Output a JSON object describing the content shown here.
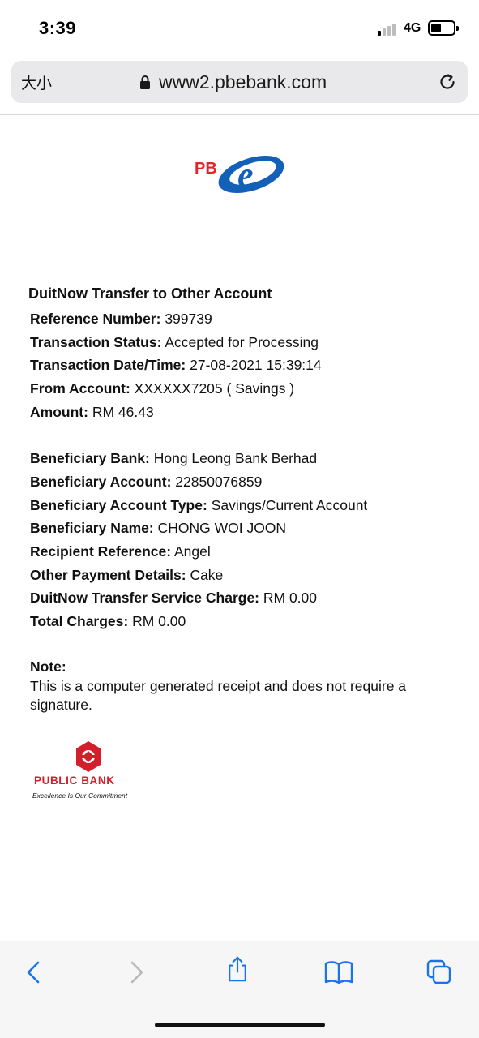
{
  "status_bar": {
    "time": "3:39",
    "network": "4G"
  },
  "browser": {
    "text_size_label": "大小",
    "url": "www2.pbebank.com",
    "icons": {
      "lock": "lock-icon",
      "reload": "reload-icon",
      "back": "back-icon",
      "forward": "forward-icon",
      "share": "share-icon",
      "bookmarks": "bookmarks-icon",
      "tabs": "tabs-icon"
    }
  },
  "logo": {
    "pbe_text": "PB",
    "pbe_letter": "e"
  },
  "receipt": {
    "title": "DuitNow Transfer to Other Account",
    "transaction": [
      {
        "label": "Reference Number:",
        "value": "399739"
      },
      {
        "label": "Transaction Status:",
        "value": "Accepted for Processing"
      },
      {
        "label": "Transaction Date/Time:",
        "value": "27-08-2021 15:39:14"
      },
      {
        "label": "From Account:",
        "value": "XXXXXX7205 ( Savings )"
      },
      {
        "label": "Amount:",
        "value": "RM 46.43"
      }
    ],
    "beneficiary": [
      {
        "label": "Beneficiary Bank:",
        "value": "Hong Leong Bank Berhad"
      },
      {
        "label": "Beneficiary Account:",
        "value": "22850076859"
      },
      {
        "label": "Beneficiary Account Type:",
        "value": "Savings/Current Account"
      },
      {
        "label": "Beneficiary Name:",
        "value": "CHONG WOI JOON"
      },
      {
        "label": "Recipient Reference:",
        "value": "Angel"
      },
      {
        "label": "Other Payment Details:",
        "value": "Cake"
      },
      {
        "label": "DuitNow Transfer Service Charge:",
        "value": "RM 0.00"
      },
      {
        "label": "Total Charges:",
        "value": "RM 0.00"
      }
    ],
    "note_title": "Note:",
    "note_text": "This is a computer generated receipt and does not require a signature."
  },
  "bank_logo": {
    "name": "PUBLIC BANK",
    "tagline": "Excellence Is Our Commitment"
  },
  "colors": {
    "pbe_red": "#e2232a",
    "pbe_blue": "#1360b8",
    "public_bank_red": "#d21f2b",
    "ios_blue": "#1a73e8",
    "disabled_gray": "#b9b9bc"
  }
}
